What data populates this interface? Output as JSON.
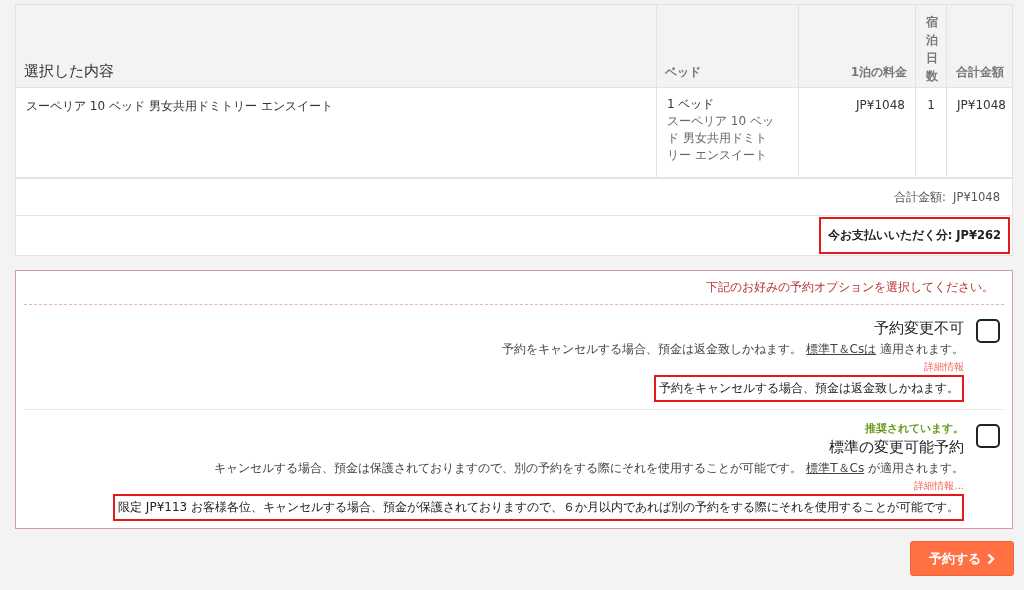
{
  "table": {
    "columns": [
      {
        "label": "選択した内容"
      },
      {
        "label": "ベッド"
      },
      {
        "label": "1泊の料金"
      },
      {
        "label": "宿泊日数"
      },
      {
        "label": "合計金額"
      }
    ],
    "rows": [
      {
        "room": "スーペリア 10 ベッド 男女共用ドミトリー エンスイート",
        "beds": "1 ベッド",
        "bed_detail": "スーペリア 10 ベッド 男女共用ドミトリー エンスイート",
        "price": "JP¥1048",
        "nights": "1",
        "total": "JP¥1048"
      }
    ],
    "total_label": "合計金額:",
    "total_value": "JP¥1048",
    "pay_now": "今お支払いいただく分:  JP¥262"
  },
  "options": {
    "prompt": "下記のお好みの予約オプションを選択してください。",
    "items": [
      {
        "title": "予約変更不可",
        "text_before": "予約をキャンセルする場合、預金は返金致しかねます。",
        "link": "標準T＆Csは",
        "text_after": "適用されます。",
        "more": "詳細情報",
        "tooltip": "予約をキャンセルする場合、預金は返金致しかねます。",
        "checked": false
      },
      {
        "badge": "推奨されています。",
        "title": "標準の変更可能予約",
        "text_before": "キャンセルする場合、預金は保護されておりますので、別の予約をする際にそれを使用することが可能です。",
        "link": "標準T＆Cs",
        "text_after": "が適用されます。",
        "more": "詳細情報...",
        "tooltip": "限定 JP¥113 お客様各位、キャンセルする場合、預金が保護されておりますので、６か月以内であれば別の予約をする際にそれを使用することが可能です。",
        "checked": false
      }
    ]
  },
  "book_button": "予約する"
}
